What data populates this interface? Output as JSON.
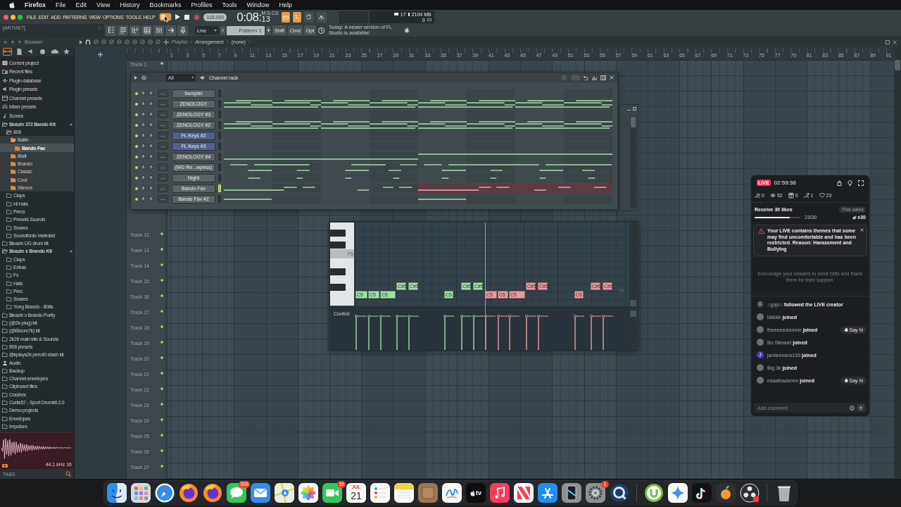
{
  "menu_bar": {
    "app": "Firefox",
    "items": [
      "File",
      "Edit",
      "View",
      "History",
      "Bookmarks",
      "Profiles",
      "Tools",
      "Window",
      "Help"
    ]
  },
  "fl_toolbar": {
    "menu": [
      "FILE",
      "EDIT",
      "ADD",
      "PATTERNS",
      "VIEW",
      "OPTIONS",
      "TOOLS",
      "HELP"
    ],
    "tempo": "118.000",
    "time": {
      "main": "0:08:",
      "fraction": "13",
      "unit": "M:S:CS"
    },
    "monitor": {
      "value_1": "17",
      "value_2": "2104 MB",
      "value_3": "0"
    },
    "hint": "[AR7I4E7]",
    "snap": "Line",
    "pattern": "Pattern 1",
    "modifier_keys": [
      "Shift",
      "Cmd",
      "Opt"
    ],
    "news": "Today: A newer version of FL Studio is available!"
  },
  "browser": {
    "title": "Browser",
    "tabs": [
      {
        "kind": "all",
        "selected": true
      },
      {
        "kind": "files",
        "selected": false
      },
      {
        "kind": "speaker",
        "selected": false
      },
      {
        "kind": "plugin",
        "selected": false
      },
      {
        "kind": "cloud",
        "selected": false
      },
      {
        "kind": "star",
        "selected": false
      }
    ],
    "tree": [
      {
        "label": "Current project",
        "kind": "project",
        "expanded": false,
        "selected": false
      },
      {
        "label": "Recent files",
        "kind": "recent",
        "expanded": false,
        "selected": false
      },
      {
        "label": "Plugin database",
        "kind": "plugins",
        "expanded": false,
        "selected": false
      },
      {
        "label": "Plugin presets",
        "kind": "plugin-presets",
        "expanded": false,
        "selected": false
      },
      {
        "label": "Channel presets",
        "kind": "channel-presets",
        "expanded": false,
        "selected": false
      },
      {
        "label": "Mixer presets",
        "kind": "mixer-presets",
        "expanded": false,
        "selected": false
      },
      {
        "label": "Scores",
        "kind": "scores",
        "expanded": false,
        "selected": false
      },
      {
        "label": "$leazin 372 Bando Kit",
        "kind": "folder",
        "expanded": true,
        "selected": false,
        "children": [
          {
            "label": "808",
            "kind": "folder",
            "expanded": true,
            "selected": false,
            "children": [
              {
                "label": "Ballin",
                "kind": "pack",
                "expanded": true,
                "selected": false,
                "children": [
                  {
                    "label": "Bando Fav",
                    "kind": "pack",
                    "expanded": false,
                    "selected": true
                  }
                ]
              },
              {
                "label": "Blatt",
                "kind": "pack",
                "expanded": false,
                "selected": false
              },
              {
                "label": "Brando",
                "kind": "pack",
                "expanded": false,
                "selected": false
              },
              {
                "label": "Classic",
                "kind": "pack",
                "expanded": false,
                "selected": false
              },
              {
                "label": "Cool",
                "kind": "pack",
                "expanded": false,
                "selected": false
              },
              {
                "label": "Silence",
                "kind": "pack",
                "expanded": false,
                "selected": false
              }
            ]
          },
          {
            "label": "Claps",
            "kind": "folder",
            "expanded": false,
            "selected": false
          },
          {
            "label": "Hi Hats",
            "kind": "folder",
            "expanded": false,
            "selected": false
          },
          {
            "label": "Percs",
            "kind": "folder",
            "expanded": false,
            "selected": false
          },
          {
            "label": "Presets Sounds",
            "kind": "folder",
            "expanded": false,
            "selected": false
          },
          {
            "label": "Snares",
            "kind": "folder",
            "expanded": false,
            "selected": false
          },
          {
            "label": "Soundfonts Variedad",
            "kind": "folder",
            "expanded": false,
            "selected": false
          }
        ]
      },
      {
        "label": "$leazin UG drum kit",
        "kind": "folder",
        "expanded": false,
        "selected": false
      },
      {
        "label": "$leazin x Brando Kit",
        "kind": "folder",
        "expanded": true,
        "selected": false,
        "children": [
          {
            "label": "Claps",
            "kind": "folder",
            "expanded": false,
            "selected": false
          },
          {
            "label": "Extras",
            "kind": "folder",
            "expanded": false,
            "selected": false
          },
          {
            "label": "Fx",
            "kind": "folder",
            "expanded": false,
            "selected": false
          },
          {
            "label": "Hats",
            "kind": "folder",
            "expanded": false,
            "selected": false
          },
          {
            "label": "Perc",
            "kind": "folder",
            "expanded": false,
            "selected": false
          },
          {
            "label": "Snares",
            "kind": "folder",
            "expanded": false,
            "selected": false
          },
          {
            "label": "Yung Brando - 808s",
            "kind": "folder",
            "expanded": false,
            "selected": false
          }
        ]
      },
      {
        "label": "$leazin x Brando Purity",
        "kind": "folder",
        "expanded": false,
        "selected": false
      },
      {
        "label": "(@2k-plug) kit",
        "kind": "folder",
        "expanded": false,
        "selected": false
      },
      {
        "label": "(@Bloom7k) kit",
        "kind": "folder",
        "expanded": false,
        "selected": false
      },
      {
        "label": "2k26 main kits & Sounds",
        "kind": "folder",
        "expanded": false,
        "selected": false
      },
      {
        "label": "808 presets",
        "kind": "folder",
        "expanded": false,
        "selected": false
      },
      {
        "label": "@kplays2k perc40 stash kit",
        "kind": "folder",
        "expanded": false,
        "selected": false
      },
      {
        "label": "Audio",
        "kind": "audio",
        "expanded": false,
        "selected": false
      },
      {
        "label": "Backup",
        "kind": "folder",
        "expanded": false,
        "selected": false
      },
      {
        "label": "Channel envelopes",
        "kind": "folder",
        "expanded": false,
        "selected": false
      },
      {
        "label": "Clipboard files",
        "kind": "folder",
        "expanded": false,
        "selected": false
      },
      {
        "label": "Crashes",
        "kind": "folder",
        "expanded": false,
        "selected": false
      },
      {
        "label": "Curtis57 - Sport Drumkit 2.0",
        "kind": "folder",
        "expanded": false,
        "selected": false
      },
      {
        "label": "Demo projects",
        "kind": "folder",
        "expanded": false,
        "selected": false
      },
      {
        "label": "Envelopes",
        "kind": "folder",
        "expanded": false,
        "selected": false
      },
      {
        "label": "Impulses",
        "kind": "folder",
        "expanded": false,
        "selected": false
      }
    ],
    "preview": {
      "readout": "44.1 kHz 16"
    },
    "footer": "TABS"
  },
  "playlist": {
    "caption": "Playlist",
    "breadcrumb": [
      "Arrangement",
      "(none)"
    ],
    "ruler": [
      "1",
      "3",
      "5",
      "7",
      "9",
      "11",
      "13",
      "15",
      "17",
      "19",
      "21",
      "23",
      "25",
      "27",
      "29",
      "31",
      "33",
      "35",
      "37",
      "39",
      "41",
      "43",
      "45",
      "47",
      "49",
      "51",
      "53",
      "55",
      "57",
      "59",
      "61",
      "63",
      "65",
      "67",
      "69",
      "71",
      "73",
      "75",
      "77",
      "79",
      "81",
      "83",
      "85",
      "87",
      "89",
      "91"
    ],
    "tracks": [
      "Track 1",
      "Track 12",
      "Track 13",
      "Track 14",
      "Track 15",
      "Track 16",
      "Track 17",
      "Track 18",
      "Track 19",
      "Track 20",
      "Track 21",
      "Track 22",
      "Track 23",
      "Track 24",
      "Track 25",
      "Track 26",
      "Track 27"
    ]
  },
  "channel_rack": {
    "filter": "All",
    "title": "Channel rack",
    "channels": [
      {
        "name": "Sampler",
        "mixer_track": "---",
        "color": "#5b6367",
        "selected": false
      },
      {
        "name": "ZENOLOGY",
        "mixer_track": "---",
        "color": "#5b6367",
        "selected": false
      },
      {
        "name": "ZENOLOGY #3",
        "mixer_track": "---",
        "color": "#5b6367",
        "selected": false
      },
      {
        "name": "ZENOLOGY #2",
        "mixer_track": "---",
        "color": "#5b6367",
        "selected": false
      },
      {
        "name": "FL Keys #2",
        "mixer_track": "---",
        "color": "#52608c",
        "selected": false
      },
      {
        "name": "FL Keys #3",
        "mixer_track": "---",
        "color": "#52608c",
        "selected": false
      },
      {
        "name": "ZENOLOGY #4",
        "mixer_track": "---",
        "color": "#5b6367",
        "selected": false
      },
      {
        "name": "(MG Re...wpess)",
        "mixer_track": "---",
        "color": "#5b6367",
        "selected": false
      },
      {
        "name": "Night",
        "mixer_track": "---",
        "color": "#5b6367",
        "selected": false
      },
      {
        "name": "Bando Fav",
        "mixer_track": "---",
        "color": "#5b6367",
        "selected": true
      },
      {
        "name": "Bando Fav #2",
        "mixer_track": "---",
        "color": "#5b6367",
        "selected": false
      }
    ]
  },
  "piano_roll": {
    "key_label": "F5",
    "control_label": "Control",
    "notes": [
      {
        "label": "C5",
        "color": "#a3e0a6"
      },
      {
        "label": "C5",
        "color": "#a3e0a6"
      },
      {
        "label": "C5",
        "color": "#a3e0a6"
      },
      {
        "label": "C#5",
        "color": "#a3e0a6"
      },
      {
        "label": "C#5",
        "color": "#a3e0a6"
      },
      {
        "label": "C5",
        "color": "#a3e0a6"
      },
      {
        "label": "C#5",
        "color": "#a3e0a6"
      },
      {
        "label": "C#5",
        "color": "#a3e0a6"
      },
      {
        "label": "C5",
        "color": "#ee9aa2"
      },
      {
        "label": "C5",
        "color": "#ee9aa2"
      },
      {
        "label": "C5",
        "color": "#ee9aa2"
      },
      {
        "label": "C#5",
        "color": "#ee9aa2"
      },
      {
        "label": "C#5",
        "color": "#ee9aa2"
      },
      {
        "label": "C5",
        "color": "#ee9aa2"
      },
      {
        "label": "C#5",
        "color": "#ee9aa2"
      },
      {
        "label": "C#5",
        "color": "#ee9aa2"
      }
    ]
  },
  "live_panel": {
    "badge": "LIVE",
    "timer": "02:59:38",
    "stats": [
      {
        "kind": "people",
        "value": "0"
      },
      {
        "kind": "views",
        "value": "52"
      },
      {
        "kind": "gifts",
        "value": "0"
      },
      {
        "kind": "follows",
        "value": "1"
      },
      {
        "kind": "likes",
        "value": "23"
      }
    ],
    "goal": {
      "title": "Receive 30 likes",
      "period": "This week",
      "level": 0.767,
      "progress": "23/30",
      "reward": "x30"
    },
    "alert": "Your LIVE contains themes that some may find uncomfortable and has been restricted. Reason: Harassment and Bullying",
    "prompt": "Encourage your viewers to send Gifts and thank them for their support.",
    "feed": [
      {
        "kind": "icon",
        "user": "☝gojo☝",
        "action": "followed the LIVE creator"
      },
      {
        "kind": "photo",
        "user": "ldkkkk",
        "action": "joined"
      },
      {
        "kind": "photo",
        "user": "theeeeedonnnn",
        "action": "joined",
        "button": "Say hi"
      },
      {
        "kind": "photo",
        "user": "Bo Stewart",
        "action": "joined"
      },
      {
        "kind": "initial",
        "initial": "J",
        "user": "jamieevans139",
        "action": "joined"
      },
      {
        "kind": "photo",
        "user": "Big 3k",
        "action": "joined"
      },
      {
        "kind": "photo",
        "user": "miaathadonnn",
        "action": "joined",
        "button": "Say hi"
      }
    ],
    "comment": {
      "placeholder": "Add comment"
    }
  },
  "dock": {
    "groups": [
      [
        {
          "kind": "finder"
        },
        {
          "kind": "launchpad"
        },
        {
          "kind": "safari"
        },
        {
          "kind": "firefox"
        },
        {
          "kind": "firefox"
        },
        {
          "kind": "messages",
          "badge": "306"
        },
        {
          "kind": "mail"
        },
        {
          "kind": "maps"
        },
        {
          "kind": "photos"
        },
        {
          "kind": "facetime",
          "badge": "16"
        },
        {
          "kind": "calendar",
          "month": "JUL",
          "day": "21"
        },
        {
          "kind": "reminders"
        },
        {
          "kind": "notes"
        },
        {
          "kind": "brown"
        },
        {
          "kind": "freeform"
        },
        {
          "kind": "tv",
          "label": "tv"
        },
        {
          "kind": "music"
        },
        {
          "kind": "news"
        },
        {
          "kind": "appstore"
        },
        {
          "kind": "phone"
        },
        {
          "kind": "settings",
          "badge": "1"
        },
        {
          "kind": "quicktime"
        }
      ],
      [
        {
          "kind": "utorrent"
        },
        {
          "kind": "gemini"
        },
        {
          "kind": "tiktok"
        },
        {
          "kind": "fl"
        },
        {
          "kind": "obs"
        }
      ],
      [
        {
          "kind": "trash"
        }
      ]
    ]
  }
}
